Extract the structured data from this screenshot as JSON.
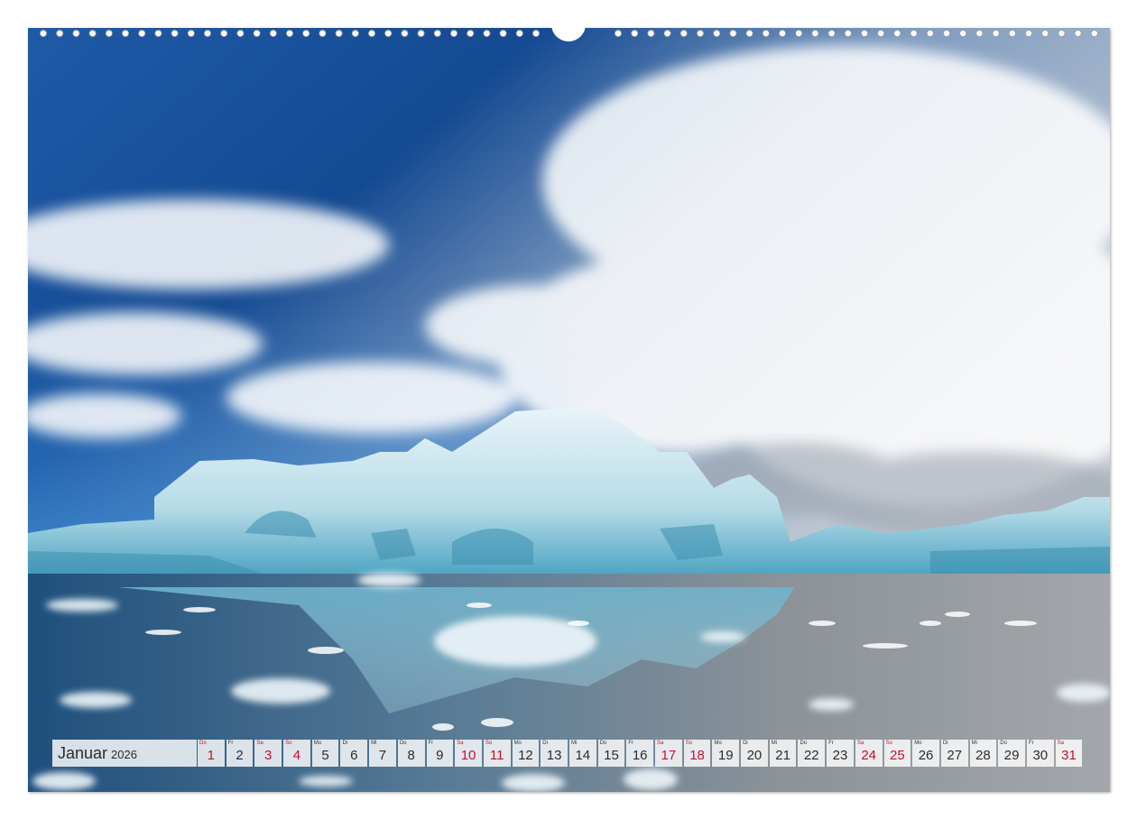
{
  "calendar": {
    "month": "Januar",
    "year": "2026",
    "colors": {
      "weekday_text": "#2b2b2b",
      "weekend_text": "#c8102e",
      "cell_bg": "#ffffffd1"
    },
    "days": [
      {
        "wd": "Do",
        "d": "1",
        "red": true
      },
      {
        "wd": "Fr",
        "d": "2",
        "red": false
      },
      {
        "wd": "Sa",
        "d": "3",
        "red": true
      },
      {
        "wd": "So",
        "d": "4",
        "red": true
      },
      {
        "wd": "Mo",
        "d": "5",
        "red": false
      },
      {
        "wd": "Di",
        "d": "6",
        "red": false
      },
      {
        "wd": "Mi",
        "d": "7",
        "red": false
      },
      {
        "wd": "Do",
        "d": "8",
        "red": false
      },
      {
        "wd": "Fr",
        "d": "9",
        "red": false
      },
      {
        "wd": "Sa",
        "d": "10",
        "red": true
      },
      {
        "wd": "So",
        "d": "11",
        "red": true
      },
      {
        "wd": "Mo",
        "d": "12",
        "red": false
      },
      {
        "wd": "Di",
        "d": "13",
        "red": false
      },
      {
        "wd": "Mi",
        "d": "14",
        "red": false
      },
      {
        "wd": "Do",
        "d": "15",
        "red": false
      },
      {
        "wd": "Fr",
        "d": "16",
        "red": false
      },
      {
        "wd": "Sa",
        "d": "17",
        "red": true
      },
      {
        "wd": "So",
        "d": "18",
        "red": true
      },
      {
        "wd": "Mo",
        "d": "19",
        "red": false
      },
      {
        "wd": "Di",
        "d": "20",
        "red": false
      },
      {
        "wd": "Mi",
        "d": "21",
        "red": false
      },
      {
        "wd": "Do",
        "d": "22",
        "red": false
      },
      {
        "wd": "Fr",
        "d": "23",
        "red": false
      },
      {
        "wd": "Sa",
        "d": "24",
        "red": true
      },
      {
        "wd": "So",
        "d": "25",
        "red": true
      },
      {
        "wd": "Mo",
        "d": "26",
        "red": false
      },
      {
        "wd": "Di",
        "d": "27",
        "red": false
      },
      {
        "wd": "Mi",
        "d": "28",
        "red": false
      },
      {
        "wd": "Do",
        "d": "29",
        "red": false
      },
      {
        "wd": "Fr",
        "d": "30",
        "red": false
      },
      {
        "wd": "Sa",
        "d": "31",
        "red": true
      }
    ]
  }
}
